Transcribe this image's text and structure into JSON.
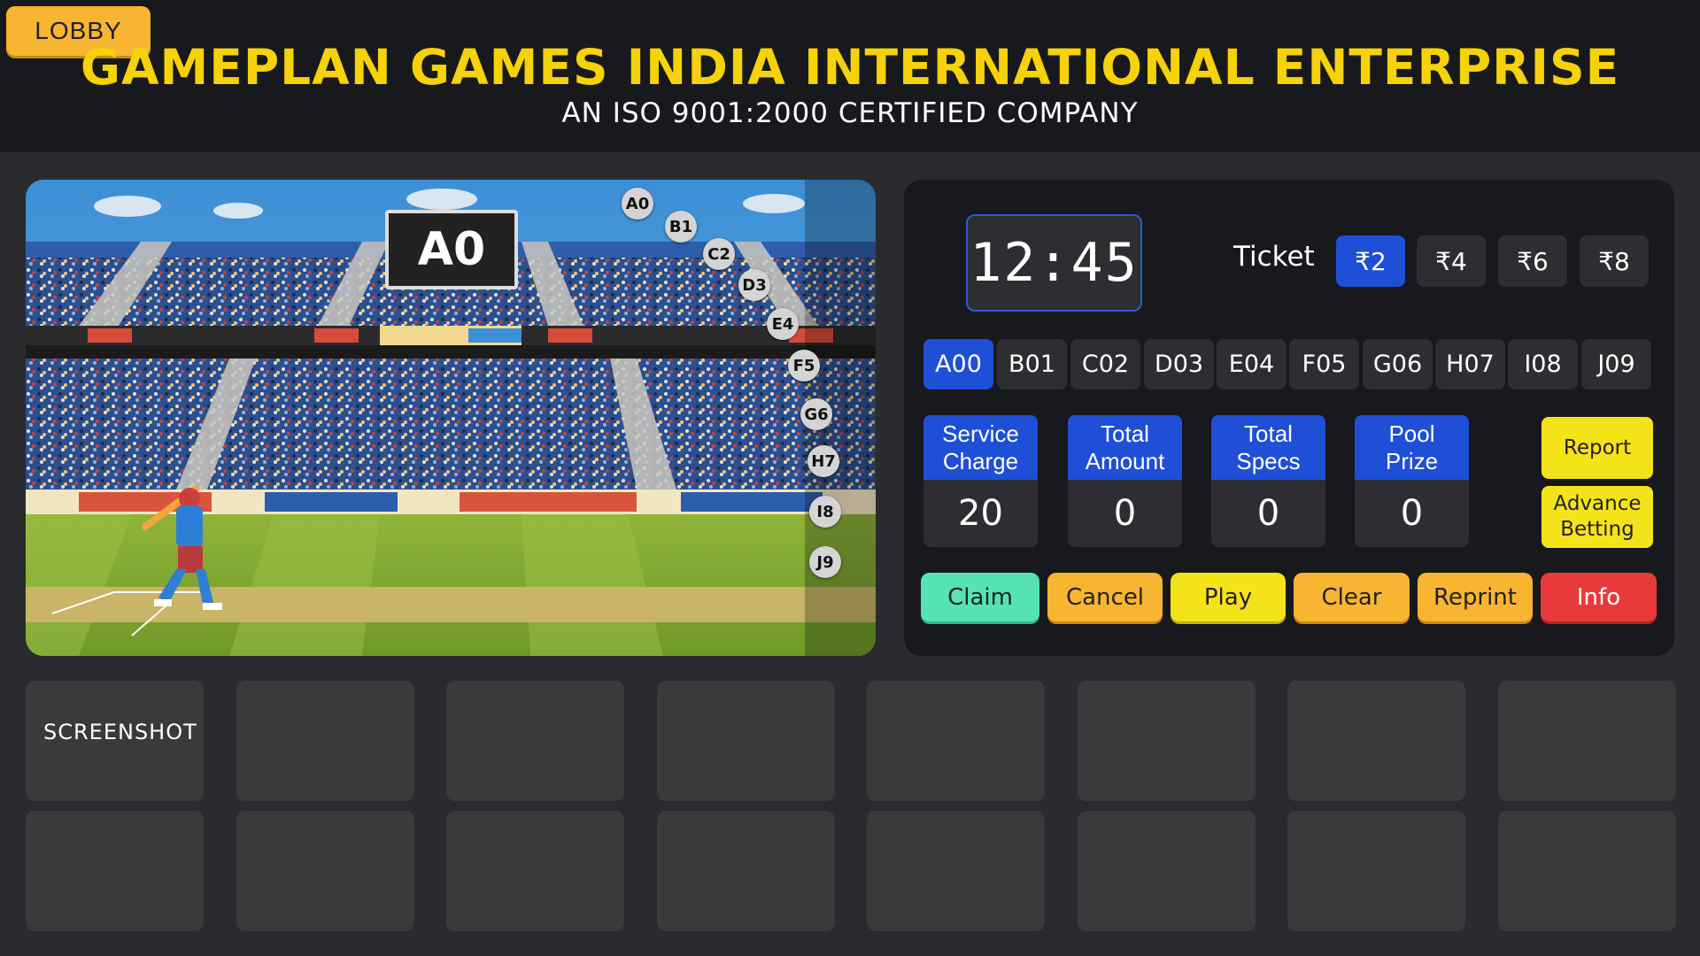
{
  "header": {
    "lobby_label": "LOBBY",
    "title": "GAMEPLAN GAMES INDIA INTERNATIONAL ENTERPRISE",
    "subtitle": "AN ISO 9001:2000 CERTIFIED COMPANY"
  },
  "game": {
    "result": "A0",
    "markers": [
      "A0",
      "B1",
      "C2",
      "D3",
      "E4",
      "F5",
      "G6",
      "H7",
      "I8",
      "J9"
    ]
  },
  "panel": {
    "timer": "12:45",
    "ticket_label": "Ticket",
    "tickets": [
      "₹2",
      "₹4",
      "₹6",
      "₹8"
    ],
    "selected_ticket": "₹2",
    "numbers": [
      "A00",
      "B01",
      "C02",
      "D03",
      "E04",
      "F05",
      "G06",
      "H07",
      "I08",
      "J09"
    ],
    "selected_number": "A00",
    "stats": [
      {
        "label": "Service Charge",
        "value": "20"
      },
      {
        "label": "Total Amount",
        "value": "0"
      },
      {
        "label": "Total Specs",
        "value": "0"
      },
      {
        "label": "Pool Prize",
        "value": "0"
      }
    ],
    "side_buttons": {
      "report": "Report",
      "advance_betting": "Advance Betting"
    },
    "actions": {
      "claim": "Claim",
      "cancel": "Cancel",
      "play": "Play",
      "clear": "Clear",
      "reprint": "Reprint",
      "info": "Info"
    }
  },
  "tiles": {
    "first_label": "SCREENSHOT"
  },
  "colors": {
    "accent_blue": "#1e4fd6",
    "title_yellow": "#f5d20a",
    "lobby_orange": "#f8b531",
    "claim_green": "#55e3b6",
    "info_red": "#e83a3a"
  }
}
